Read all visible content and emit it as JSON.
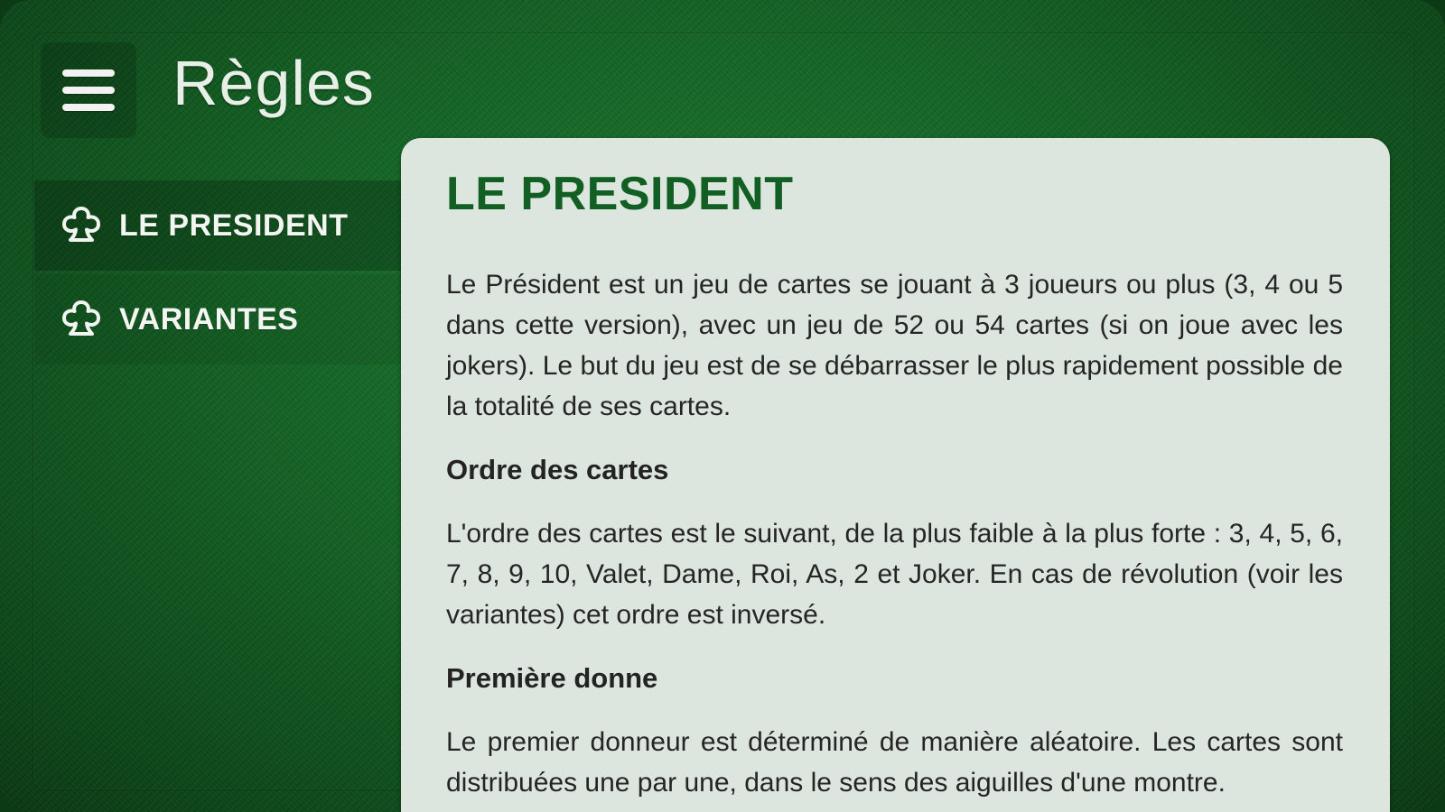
{
  "header": {
    "title": "Règles",
    "menu_icon": "hamburger-menu-icon"
  },
  "sidebar": {
    "items": [
      {
        "label": "LE PRESIDENT",
        "icon": "club-outline-icon",
        "active": true
      },
      {
        "label": "VARIANTES",
        "icon": "club-outline-icon",
        "active": false
      }
    ]
  },
  "content": {
    "title": "LE PRESIDENT",
    "intro": "Le Président est un jeu de cartes se jouant à 3 joueurs ou plus (3, 4 ou 5 dans cette version), avec un jeu de 52 ou 54 cartes (si on joue avec les jokers). Le but du jeu est de se débarrasser le plus rapidement possible de la totalité de ses cartes.",
    "sections": [
      {
        "heading": "Ordre des cartes",
        "text": "L'ordre des cartes est le suivant, de la plus faible à la plus forte : 3, 4, 5, 6, 7, 8, 9, 10, Valet, Dame, Roi, As, 2 et Joker. En cas de révolution (voir les variantes) cet ordre est inversé."
      },
      {
        "heading": "Première donne",
        "text": "Le premier donneur est déterminé de manière aléatoire. Les cartes sont distribuées une par une, dans le sens des aiguilles d'une montre."
      }
    ]
  },
  "colors": {
    "felt": "#146325",
    "panel": "#dde6de",
    "accent_title": "#115f22",
    "body_text": "#252525"
  }
}
